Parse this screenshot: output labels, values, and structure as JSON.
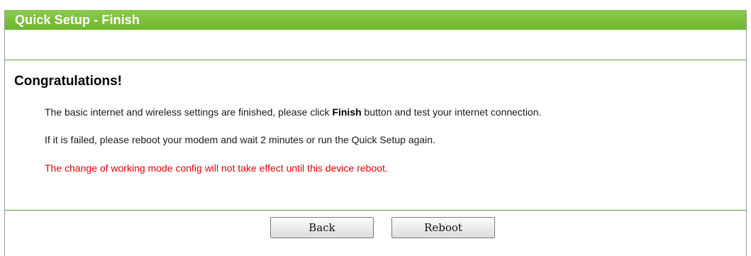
{
  "header": {
    "title": "Quick Setup - Finish"
  },
  "content": {
    "heading": "Congratulations!",
    "line1_before": "The basic internet and wireless settings are finished, please click ",
    "line1_bold": "Finish",
    "line1_after": " button and test your internet connection.",
    "line2": "If it is failed, please reboot your modem and wait 2 minutes or run the Quick Setup again.",
    "warning": "The change of working mode config will not take effect until this device reboot."
  },
  "buttons": {
    "back": "Back",
    "reboot": "Reboot"
  },
  "colors": {
    "title_bar": "#7cc043",
    "divider": "#5aa02c",
    "warning_text": "#ee0000"
  }
}
